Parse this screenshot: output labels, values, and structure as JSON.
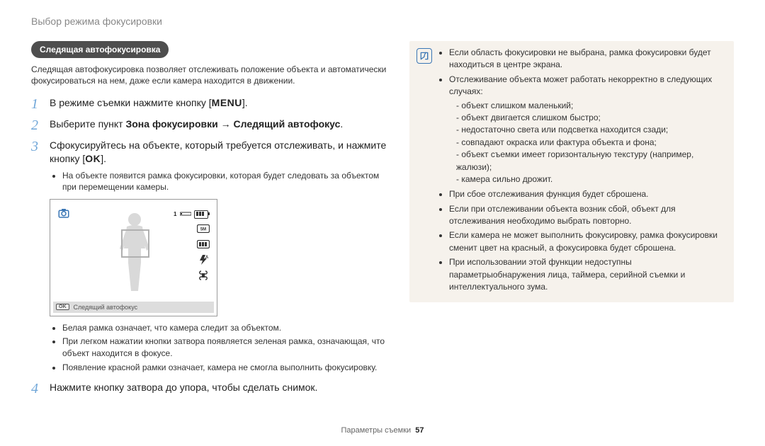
{
  "header": {
    "title": "Выбор режима фокусировки"
  },
  "left": {
    "pill": "Следящая автофокусировка",
    "intro": "Следящая автофокусировка позволяет отслеживать положение объекта и автоматически фокусироваться на нем, даже если камера находится в движении.",
    "steps": {
      "s1": {
        "num": "1",
        "pre": "В режиме съемки нажмите кнопку [",
        "kbd": "MENU",
        "post": "]."
      },
      "s2": {
        "num": "2",
        "pre": "Выберите пункт ",
        "bold1": "Зона фокусировки",
        "arrow": " → ",
        "bold2": "Следящий автофокус",
        "post": "."
      },
      "s3": {
        "num": "3",
        "line1_pre": "Сфокусируйтесь на объекте, который требуется отслеживать, и нажмите кнопку [",
        "kbd": "OK",
        "line1_post": "].",
        "sub1": "На объекте появится рамка фокусировки, которая будет следовать за объектом при перемещении камеры."
      },
      "s4": {
        "num": "4",
        "text": "Нажмите кнопку затвора до упора, чтобы сделать снимок."
      }
    },
    "preview": {
      "ok_btn": "OK",
      "label": "Следящий автофокус",
      "zoom_label": "1",
      "flash_auto": "A"
    },
    "frame_notes": {
      "b1": "Белая рамка означает, что камера следит за объектом.",
      "b2": "При легком нажатии кнопки затвора появляется зеленая рамка, означающая, что объект находится в фокусе.",
      "b3": "Появление красной рамки означает, камера не смогла выполнить фокусировку."
    }
  },
  "right": {
    "n1": "Если область фокусировки не выбрана, рамка фокусировки будет находиться в центре экрана.",
    "n2": "Отслеживание объекта может работать некорректно в следующих случаях:",
    "n2a": "объект слишком маленький;",
    "n2b": "объект двигается слишком быстро;",
    "n2c": "недостаточно света или подсветка находится сзади;",
    "n2d": "совпадают окраска или фактура объекта и фона;",
    "n2e": "объект съемки имеет горизонтальную текстуру (например, жалюзи);",
    "n2f": "камера сильно дрожит.",
    "n3": "При сбое отслеживания функция будет сброшена.",
    "n4": "Если при отслеживании объекта возник сбой, объект для отслеживания необходимо выбрать повторно.",
    "n5": "Если камера не может выполнить фокусировку, рамка фокусировки сменит цвет на красный, а фокусировка будет сброшена.",
    "n6": "При использовании этой функции недоступны параметрыобнаружения лица, таймера, серийной съемки и интеллектуального зума."
  },
  "footer": {
    "label": "Параметры съемки",
    "page": "57"
  }
}
